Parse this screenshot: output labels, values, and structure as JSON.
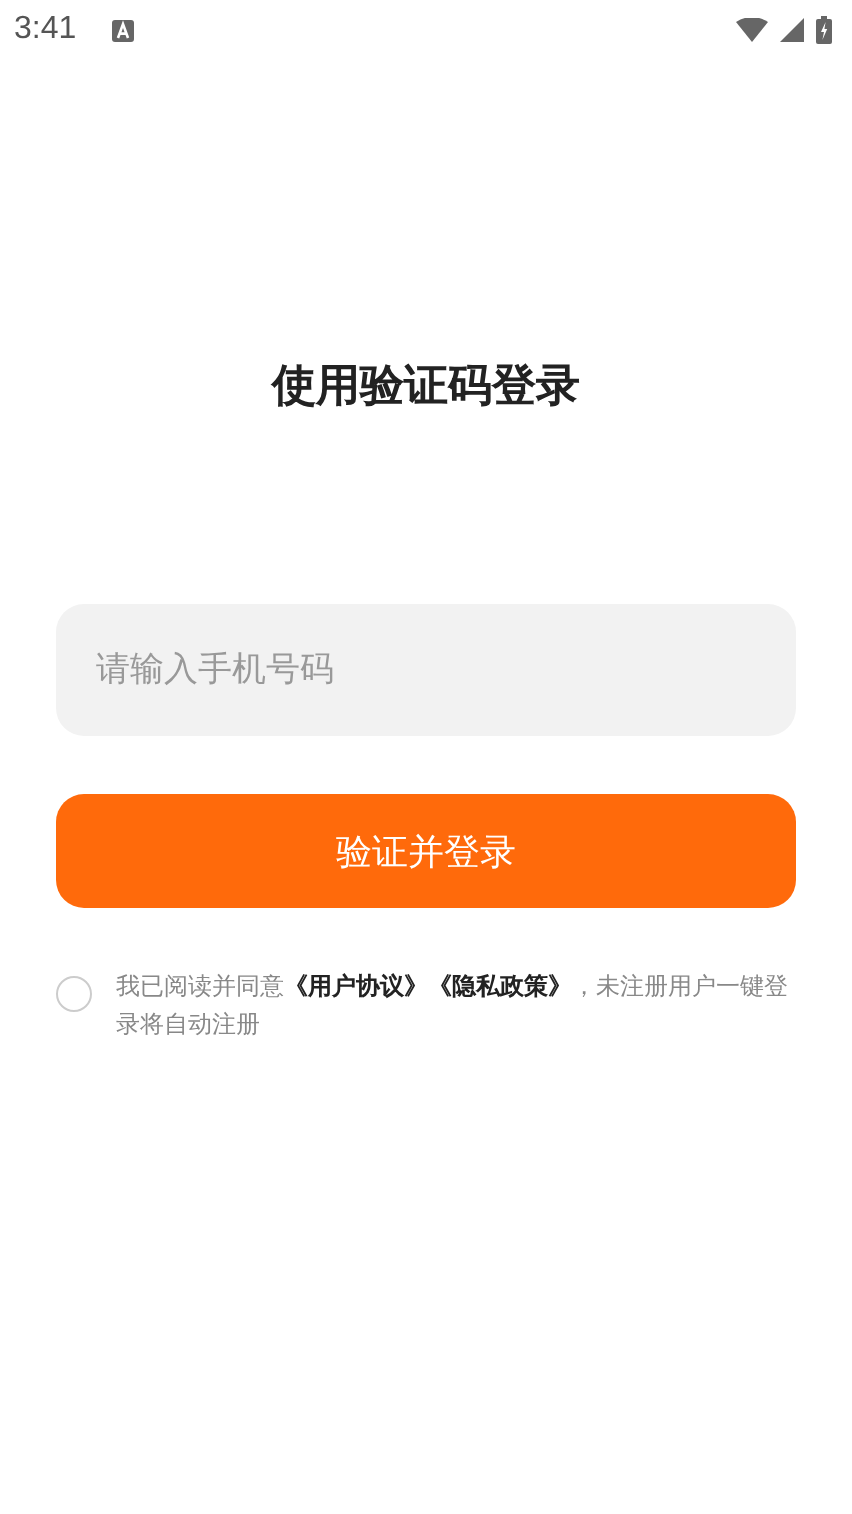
{
  "status_bar": {
    "time": "3:41"
  },
  "title": "使用验证码登录",
  "phone_field": {
    "placeholder": "请输入手机号码"
  },
  "submit_button": "验证并登录",
  "agreement": {
    "checked": false,
    "parts": [
      {
        "kind": "text",
        "text": "我已阅读并同意"
      },
      {
        "kind": "link",
        "text": "《用户协议》"
      },
      {
        "kind": "link",
        "text": "《隐私政策》"
      },
      {
        "kind": "text",
        "text": "，未注册用户一键登录将自动注册"
      }
    ]
  }
}
